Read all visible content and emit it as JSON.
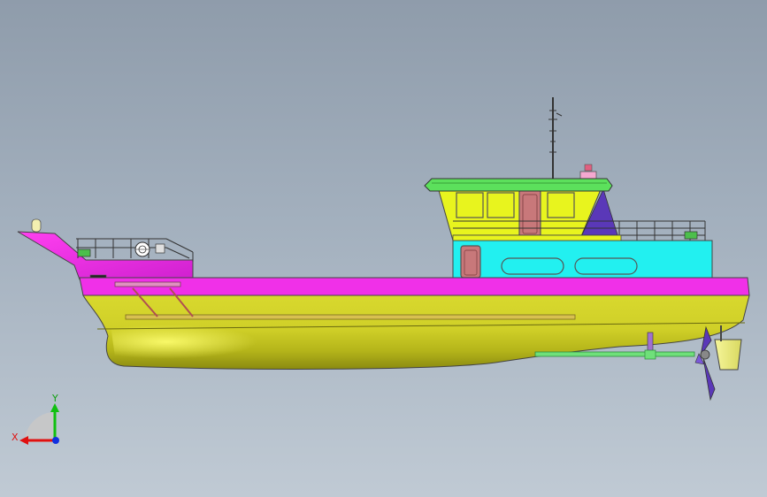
{
  "model": {
    "name": "boat-model-side-view",
    "hull_color": "#d4d42a",
    "deck_band_color": "#f030e8",
    "lower_cabin_color": "#22f0f0",
    "upper_cabin_color": "#e6f41c",
    "roof_color": "#5ce05c",
    "rudder_color": "#f0f07c",
    "door_color": "#c8787a",
    "shaft_color": "#6fe07a",
    "stairs_color": "#5a38b8"
  },
  "triad": {
    "x_label": "X",
    "y_label": "Y",
    "x_color": "#e01010",
    "y_color": "#10c010",
    "z_color": "#1030e0"
  }
}
